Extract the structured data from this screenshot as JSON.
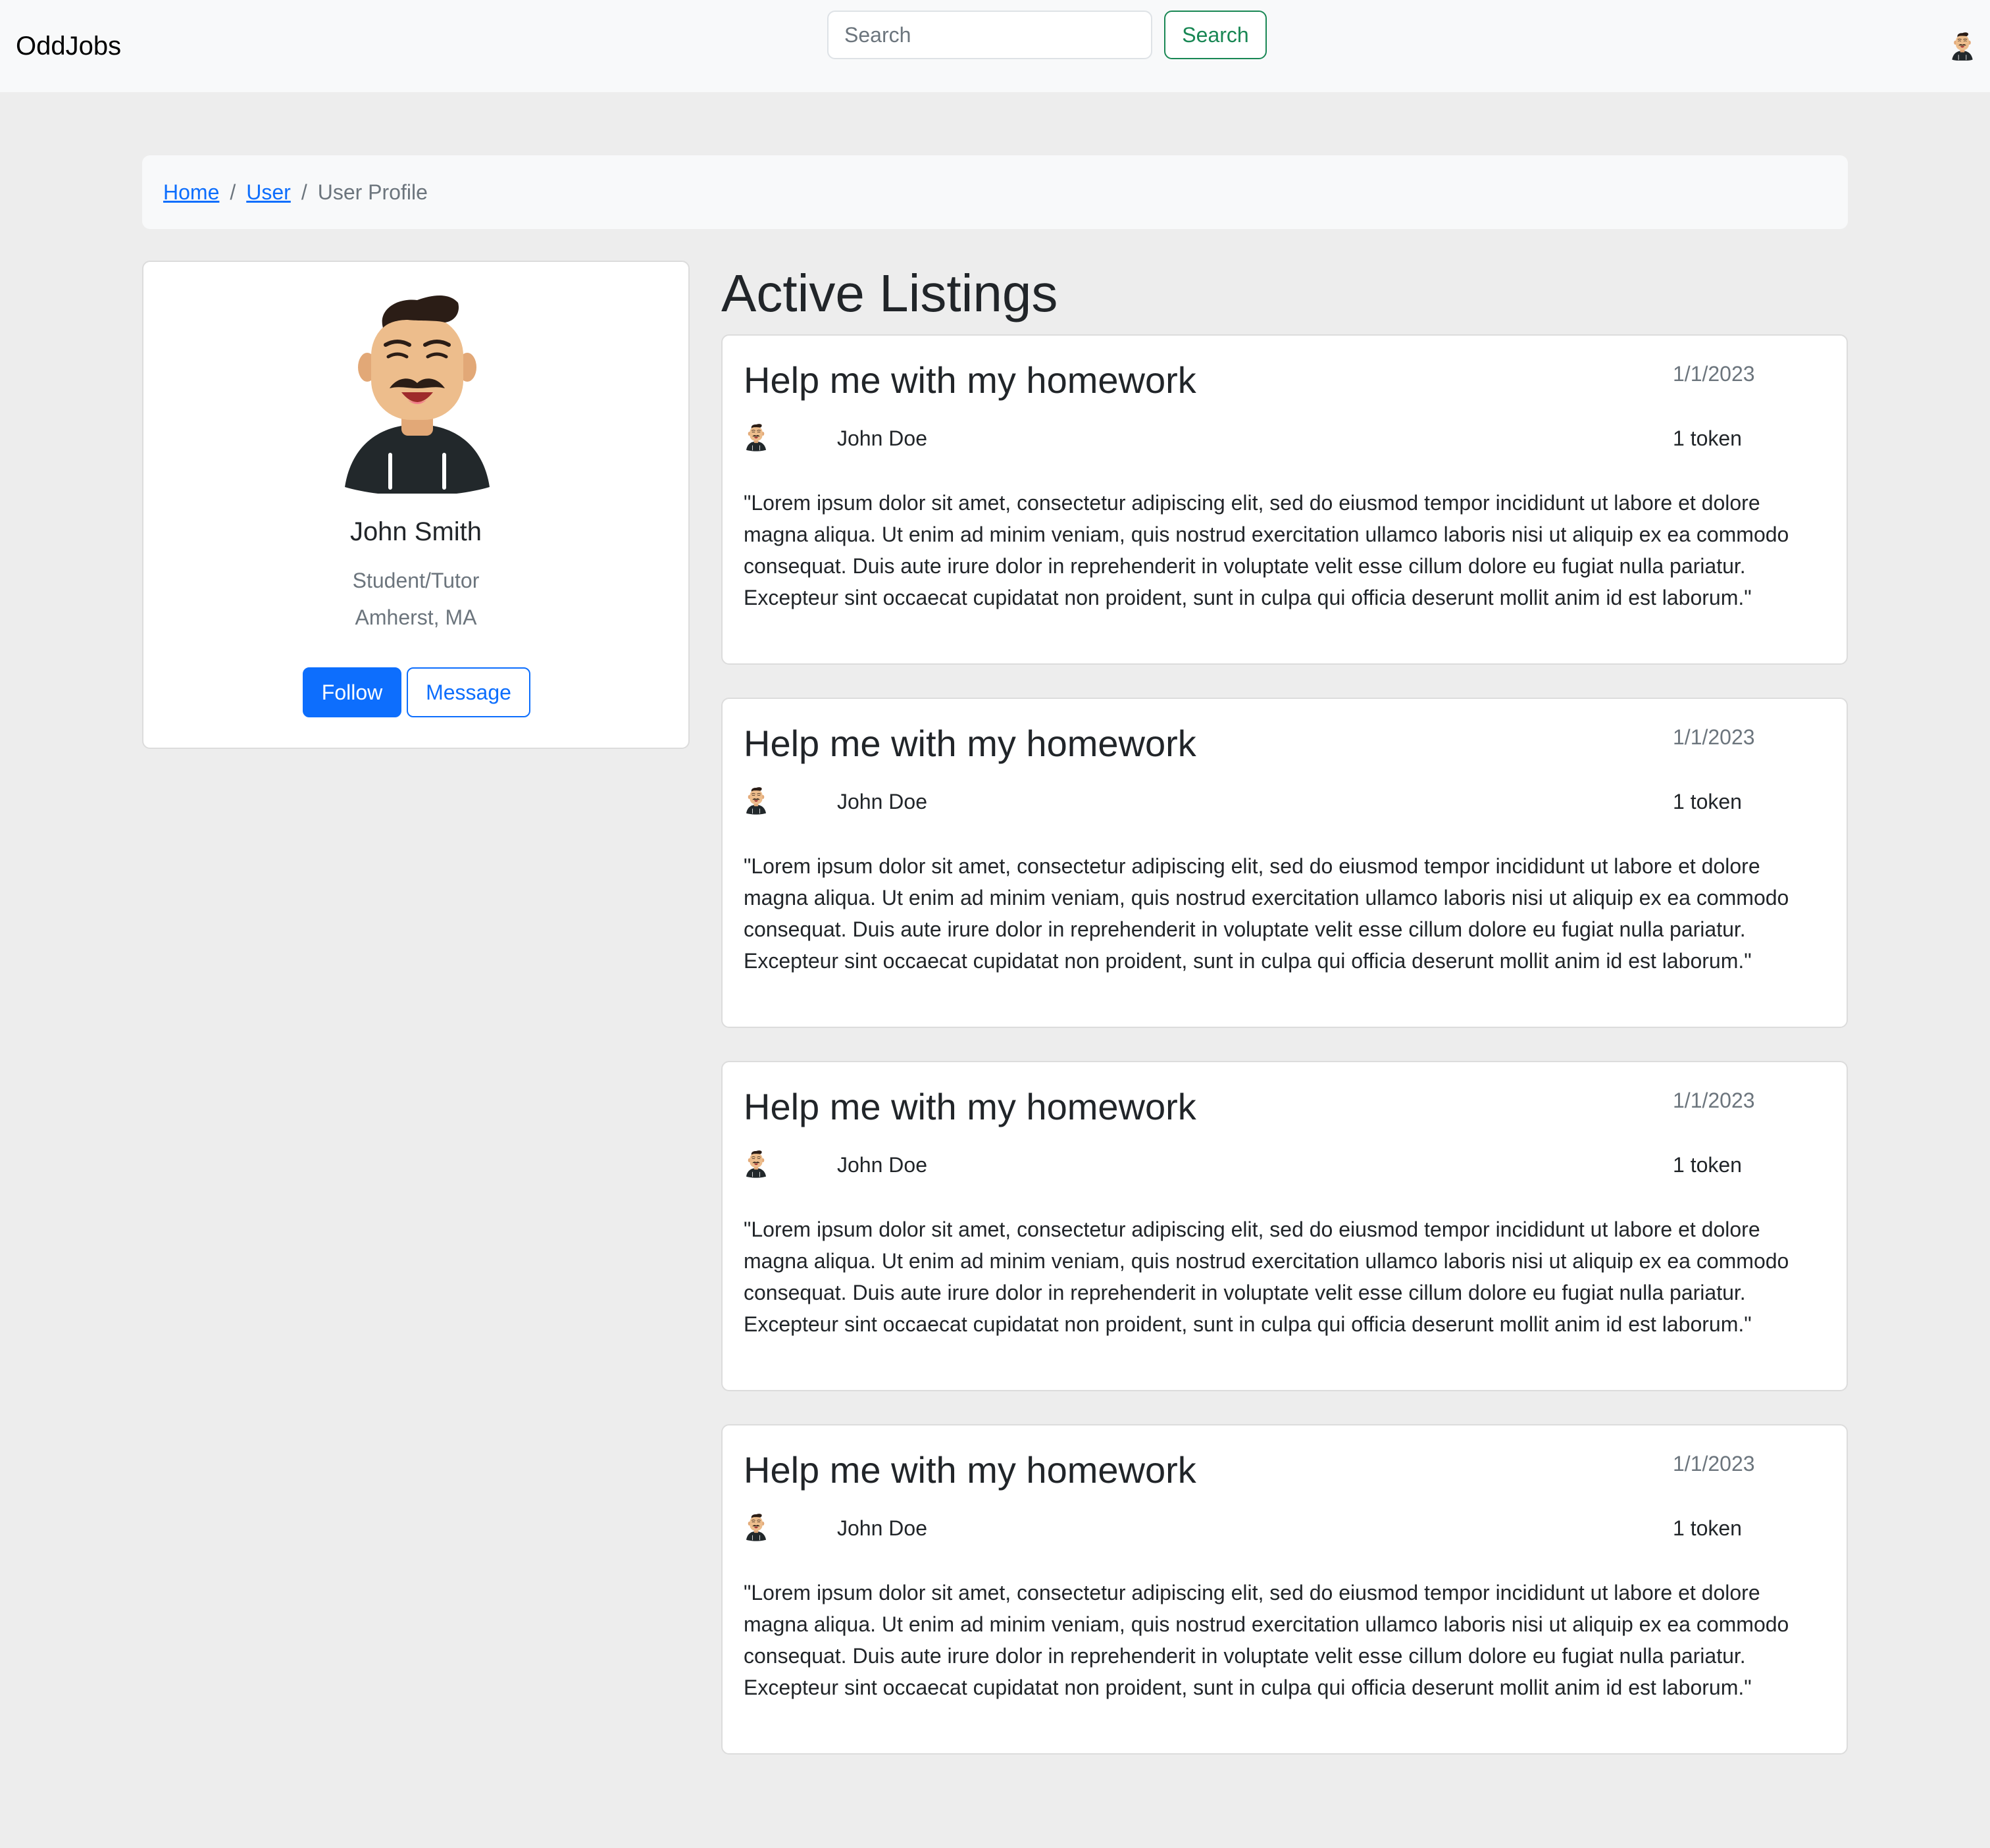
{
  "navbar": {
    "brand": "OddJobs",
    "search_placeholder": "Search",
    "search_button": "Search",
    "avatar_icon": "user-avatar-icon"
  },
  "breadcrumb": {
    "items": [
      "Home",
      "User"
    ],
    "active": "User Profile"
  },
  "profile": {
    "name": "John Smith",
    "role": "Student/Tutor",
    "location": "Amherst, MA",
    "follow_label": "Follow",
    "message_label": "Message"
  },
  "listings": {
    "heading": "Active Listings",
    "items": [
      {
        "title": "Help me with my homework",
        "date": "1/1/2023",
        "user": "John Doe",
        "tokens": "1 token",
        "description": "\"Lorem ipsum dolor sit amet, consectetur adipiscing elit, sed do eiusmod tempor incididunt ut labore et dolore magna aliqua. Ut enim ad minim veniam, quis nostrud exercitation ullamco laboris nisi ut aliquip ex ea commodo consequat. Duis aute irure dolor in reprehenderit in voluptate velit esse cillum dolore eu fugiat nulla pariatur. Excepteur sint occaecat cupidatat non proident, sunt in culpa qui officia deserunt mollit anim id est laborum.\""
      },
      {
        "title": "Help me with my homework",
        "date": "1/1/2023",
        "user": "John Doe",
        "tokens": "1 token",
        "description": "\"Lorem ipsum dolor sit amet, consectetur adipiscing elit, sed do eiusmod tempor incididunt ut labore et dolore magna aliqua. Ut enim ad minim veniam, quis nostrud exercitation ullamco laboris nisi ut aliquip ex ea commodo consequat. Duis aute irure dolor in reprehenderit in voluptate velit esse cillum dolore eu fugiat nulla pariatur. Excepteur sint occaecat cupidatat non proident, sunt in culpa qui officia deserunt mollit anim id est laborum.\""
      },
      {
        "title": "Help me with my homework",
        "date": "1/1/2023",
        "user": "John Doe",
        "tokens": "1 token",
        "description": "\"Lorem ipsum dolor sit amet, consectetur adipiscing elit, sed do eiusmod tempor incididunt ut labore et dolore magna aliqua. Ut enim ad minim veniam, quis nostrud exercitation ullamco laboris nisi ut aliquip ex ea commodo consequat. Duis aute irure dolor in reprehenderit in voluptate velit esse cillum dolore eu fugiat nulla pariatur. Excepteur sint occaecat cupidatat non proident, sunt in culpa qui officia deserunt mollit anim id est laborum.\""
      },
      {
        "title": "Help me with my homework",
        "date": "1/1/2023",
        "user": "John Doe",
        "tokens": "1 token",
        "description": "\"Lorem ipsum dolor sit amet, consectetur adipiscing elit, sed do eiusmod tempor incididunt ut labore et dolore magna aliqua. Ut enim ad minim veniam, quis nostrud exercitation ullamco laboris nisi ut aliquip ex ea commodo consequat. Duis aute irure dolor in reprehenderit in voluptate velit esse cillum dolore eu fugiat nulla pariatur. Excepteur sint occaecat cupidatat non proident, sunt in culpa qui officia deserunt mollit anim id est laborum.\""
      }
    ]
  },
  "colors": {
    "primary": "#0d6efd",
    "success": "#198754",
    "muted": "#6c757d",
    "page_bg": "#ededed",
    "navbar_bg": "#f8f9fa"
  }
}
